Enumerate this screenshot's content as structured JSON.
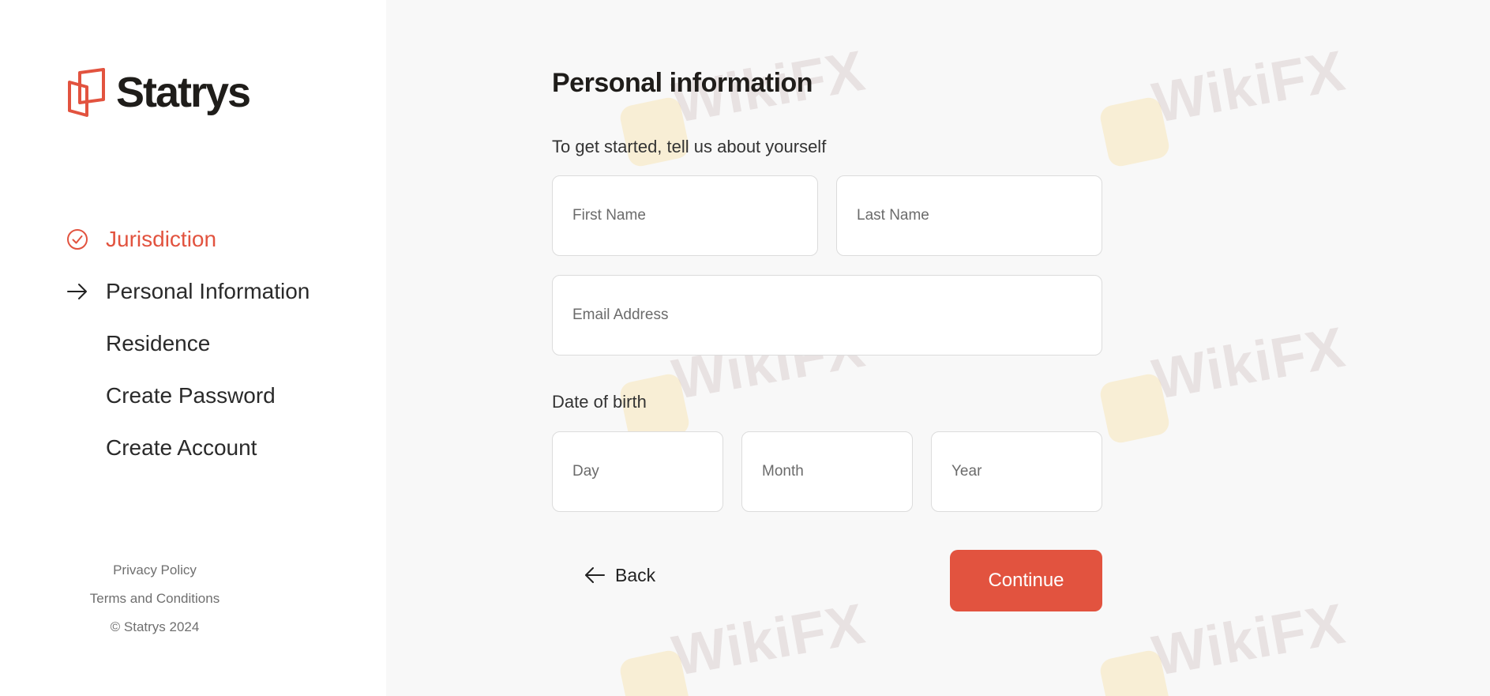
{
  "brand": {
    "name": "Statrys",
    "accent_color": "#e2533f"
  },
  "steps": [
    {
      "label": "Jurisdiction",
      "state": "completed",
      "icon": "check-circle-icon"
    },
    {
      "label": "Personal Information",
      "state": "current",
      "icon": "arrow-right-icon"
    },
    {
      "label": "Residence",
      "state": "upcoming"
    },
    {
      "label": "Create Password",
      "state": "upcoming"
    },
    {
      "label": "Create Account",
      "state": "upcoming"
    }
  ],
  "footer": {
    "privacy": "Privacy Policy",
    "terms": "Terms and Conditions",
    "copyright": "© Statrys 2024"
  },
  "form": {
    "title": "Personal information",
    "subtitle": "To get started, tell us about yourself",
    "first_name": {
      "placeholder": "First Name",
      "value": ""
    },
    "last_name": {
      "placeholder": "Last Name",
      "value": ""
    },
    "email": {
      "placeholder": "Email Address",
      "value": ""
    },
    "dob_label": "Date of birth",
    "day": {
      "placeholder": "Day",
      "value": ""
    },
    "month": {
      "placeholder": "Month",
      "value": ""
    },
    "year": {
      "placeholder": "Year",
      "value": ""
    },
    "back_label": "Back",
    "continue_label": "Continue"
  },
  "watermark": {
    "text": "WikiFX"
  }
}
